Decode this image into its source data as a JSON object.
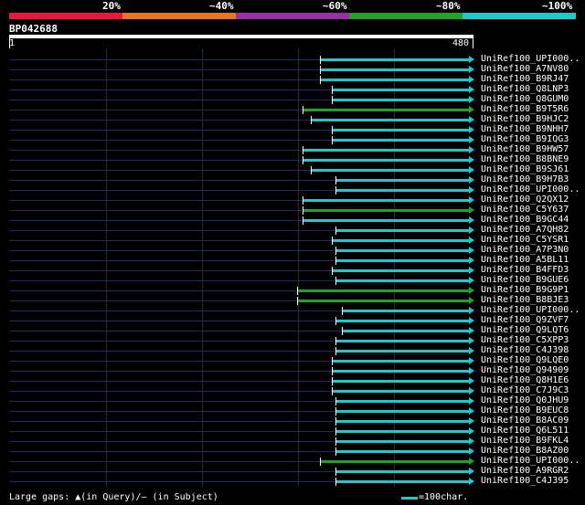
{
  "legend": {
    "labels": [
      "20%",
      "~40%",
      "~60%",
      "~80%",
      "~100%"
    ],
    "colors": [
      "#e8173b",
      "#e8761f",
      "#9a2fa6",
      "#22a328",
      "#1fc7cf"
    ]
  },
  "query": {
    "name": "BP042688",
    "start_label": "1",
    "end_label": "480",
    "length": 480
  },
  "hits": [
    {
      "name": "UniRef100_UPI000..",
      "start": 322,
      "end": 480,
      "color": "#1fc7cf"
    },
    {
      "name": "UniRef100_A7NV80",
      "start": 322,
      "end": 480,
      "color": "#1fc7cf"
    },
    {
      "name": "UniRef100_B9RJ47",
      "start": 322,
      "end": 480,
      "color": "#1fc7cf"
    },
    {
      "name": "UniRef100_Q8LNP3",
      "start": 334,
      "end": 480,
      "color": "#1fc7cf"
    },
    {
      "name": "UniRef100_Q8GUM0",
      "start": 334,
      "end": 480,
      "color": "#1fc7cf"
    },
    {
      "name": "UniRef100_B9T5R6",
      "start": 304,
      "end": 480,
      "color": "#22a328"
    },
    {
      "name": "UniRef100_B9HJC2",
      "start": 312,
      "end": 480,
      "color": "#1fc7cf"
    },
    {
      "name": "UniRef100_B9NHH7",
      "start": 334,
      "end": 480,
      "color": "#1fc7cf"
    },
    {
      "name": "UniRef100_B9IQG3",
      "start": 334,
      "end": 480,
      "color": "#1fc7cf"
    },
    {
      "name": "UniRef100_B9HW57",
      "start": 304,
      "end": 480,
      "color": "#1fc7cf"
    },
    {
      "name": "UniRef100_B8BNE9",
      "start": 304,
      "end": 480,
      "color": "#1fc7cf"
    },
    {
      "name": "UniRef100_B9SJ61",
      "start": 312,
      "end": 480,
      "color": "#1fc7cf"
    },
    {
      "name": "UniRef100_B9H7B3",
      "start": 338,
      "end": 480,
      "color": "#1fc7cf"
    },
    {
      "name": "UniRef100_UPI000..",
      "start": 338,
      "end": 480,
      "color": "#1fc7cf"
    },
    {
      "name": "UniRef100_Q2QX12",
      "start": 304,
      "end": 480,
      "color": "#1fc7cf"
    },
    {
      "name": "UniRef100_C5Y637",
      "start": 304,
      "end": 480,
      "color": "#22a328"
    },
    {
      "name": "UniRef100_B9GC44",
      "start": 304,
      "end": 480,
      "color": "#1fc7cf"
    },
    {
      "name": "UniRef100_A7QH82",
      "start": 338,
      "end": 480,
      "color": "#1fc7cf"
    },
    {
      "name": "UniRef100_C5YSR1",
      "start": 334,
      "end": 480,
      "color": "#1fc7cf"
    },
    {
      "name": "UniRef100_A7P3N0",
      "start": 338,
      "end": 480,
      "color": "#1fc7cf"
    },
    {
      "name": "UniRef100_A5BL11",
      "start": 338,
      "end": 480,
      "color": "#1fc7cf"
    },
    {
      "name": "UniRef100_B4FFD3",
      "start": 334,
      "end": 480,
      "color": "#1fc7cf"
    },
    {
      "name": "UniRef100_B9GUE6",
      "start": 338,
      "end": 480,
      "color": "#1fc7cf"
    },
    {
      "name": "UniRef100_B9G9P1",
      "start": 298,
      "end": 480,
      "color": "#22a328"
    },
    {
      "name": "UniRef100_B8BJE3",
      "start": 298,
      "end": 480,
      "color": "#22a328"
    },
    {
      "name": "UniRef100_UPI000..",
      "start": 345,
      "end": 480,
      "color": "#1fc7cf"
    },
    {
      "name": "UniRef100_Q9ZVF7",
      "start": 338,
      "end": 480,
      "color": "#1fc7cf"
    },
    {
      "name": "UniRef100_Q9LQT6",
      "start": 345,
      "end": 480,
      "color": "#1fc7cf"
    },
    {
      "name": "UniRef100_C5XPP3",
      "start": 338,
      "end": 480,
      "color": "#1fc7cf"
    },
    {
      "name": "UniRef100_C4J398",
      "start": 338,
      "end": 480,
      "color": "#1fc7cf"
    },
    {
      "name": "UniRef100_Q9LQE0",
      "start": 334,
      "end": 480,
      "color": "#1fc7cf"
    },
    {
      "name": "UniRef100_Q94909",
      "start": 334,
      "end": 480,
      "color": "#1fc7cf"
    },
    {
      "name": "UniRef100_Q8H1E6",
      "start": 334,
      "end": 480,
      "color": "#1fc7cf"
    },
    {
      "name": "UniRef100_C7J9C3",
      "start": 334,
      "end": 480,
      "color": "#1fc7cf"
    },
    {
      "name": "UniRef100_Q0JHU9",
      "start": 338,
      "end": 480,
      "color": "#1fc7cf"
    },
    {
      "name": "UniRef100_B9EUC8",
      "start": 338,
      "end": 480,
      "color": "#1fc7cf"
    },
    {
      "name": "UniRef100_B8AC09",
      "start": 338,
      "end": 480,
      "color": "#1fc7cf"
    },
    {
      "name": "UniRef100_Q6L511",
      "start": 338,
      "end": 480,
      "color": "#1fc7cf"
    },
    {
      "name": "UniRef100_B9FKL4",
      "start": 338,
      "end": 480,
      "color": "#1fc7cf"
    },
    {
      "name": "UniRef100_B8AZ00",
      "start": 338,
      "end": 480,
      "color": "#1fc7cf"
    },
    {
      "name": "UniRef100_UPI000..",
      "start": 322,
      "end": 480,
      "color": "#22a328"
    },
    {
      "name": "UniRef100_A9RGR2",
      "start": 338,
      "end": 480,
      "color": "#1fc7cf"
    },
    {
      "name": "UniRef100_C4J395",
      "start": 338,
      "end": 480,
      "color": "#1fc7cf"
    }
  ],
  "footer": {
    "left_text": "Large gaps: ▲(in Query)/– (in Subject)",
    "right_text": "=100char."
  }
}
